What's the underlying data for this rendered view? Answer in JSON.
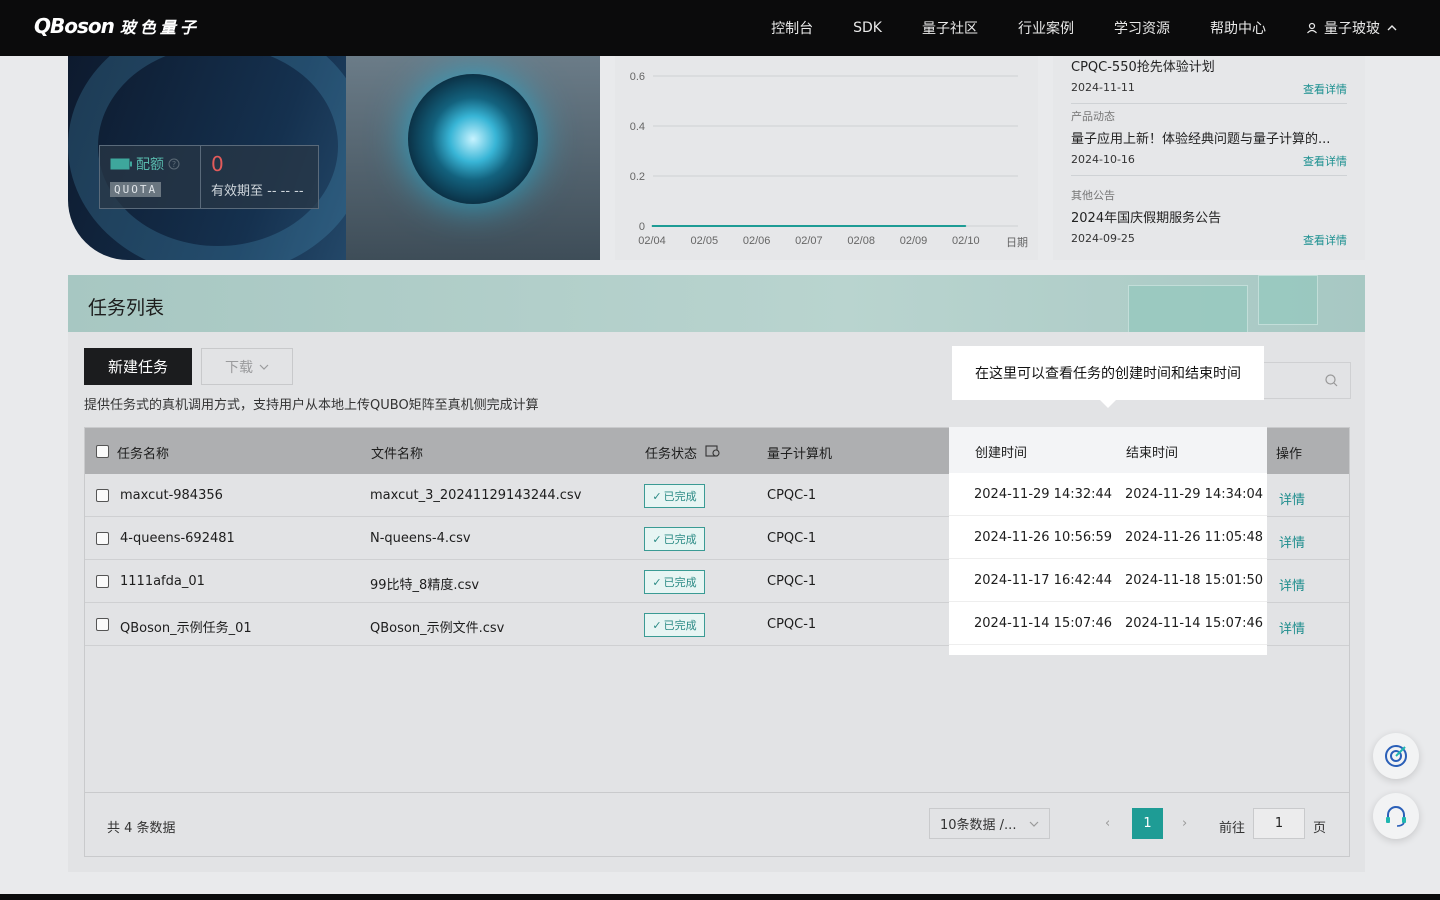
{
  "nav": {
    "logo_text": "QBoson",
    "logo_cn": "玻色量子",
    "items": [
      "控制台",
      "SDK",
      "量子社区",
      "行业案例",
      "学习资源",
      "帮助中心"
    ],
    "user_name": "量子玻玻"
  },
  "quota": {
    "label": "配额",
    "tag": "QUOTA",
    "value": "0",
    "expire_label": "有效期至 -- -- --"
  },
  "chart_data": {
    "type": "line",
    "categories": [
      "02/04",
      "02/05",
      "02/06",
      "02/07",
      "02/08",
      "02/09",
      "02/10"
    ],
    "values": [
      0,
      0,
      0,
      0,
      0,
      0,
      0
    ],
    "xlabel": "日期",
    "yticks": [
      "0",
      "0.2",
      "0.4",
      "0.6"
    ],
    "ylim": [
      0,
      0.6
    ],
    "color": "#1e9c95"
  },
  "news": [
    {
      "category": "",
      "title": "CPQC-550抢先体验计划",
      "date": "2024-11-11",
      "link": "查看详情"
    },
    {
      "category": "产品动态",
      "title": "量子应用上新！体验经典问题与量子计算的...",
      "date": "2024-10-16",
      "link": "查看详情"
    },
    {
      "category": "其他公告",
      "title": "2024年国庆假期服务公告",
      "date": "2024-09-25",
      "link": "查看详情"
    }
  ],
  "task": {
    "title": "任务列表",
    "new_button": "新建任务",
    "download_button": "下载",
    "description": "提供任务式的真机调用方式，支持用户从本地上传QUBO矩阵至真机侧完成计算",
    "columns": [
      "任务名称",
      "文件名称",
      "任务状态",
      "量子计算机",
      "创建时间",
      "结束时间",
      "操作"
    ],
    "rows": [
      {
        "name": "maxcut-984356",
        "file": "maxcut_3_20241129143244.csv",
        "status": "已完成",
        "machine": "CPQC-1",
        "created": "2024-11-29 14:32:44",
        "ended": "2024-11-29 14:34:04",
        "action": "详情"
      },
      {
        "name": "4-queens-692481",
        "file": "N-queens-4.csv",
        "status": "已完成",
        "machine": "CPQC-1",
        "created": "2024-11-26 10:56:59",
        "ended": "2024-11-26 11:05:48",
        "action": "详情"
      },
      {
        "name": "1111afda_01",
        "file": "99比特_8精度.csv",
        "status": "已完成",
        "machine": "CPQC-1",
        "created": "2024-11-17 16:42:44",
        "ended": "2024-11-18 15:01:50",
        "action": "详情"
      },
      {
        "name": "QBoson_示例任务_01",
        "file": "QBoson_示例文件.csv",
        "status": "已完成",
        "machine": "CPQC-1",
        "created": "2024-11-14 15:07:46",
        "ended": "2024-11-14 15:07:46",
        "action": "详情"
      }
    ],
    "total": "共 4 条数据",
    "page_size": "10条数据 /...",
    "current_page": "1",
    "goto_label": "前往",
    "goto_value": "1",
    "page_label": "页"
  },
  "tooltip": {
    "text": "在这里可以查看任务的创建时间和结束时间"
  }
}
